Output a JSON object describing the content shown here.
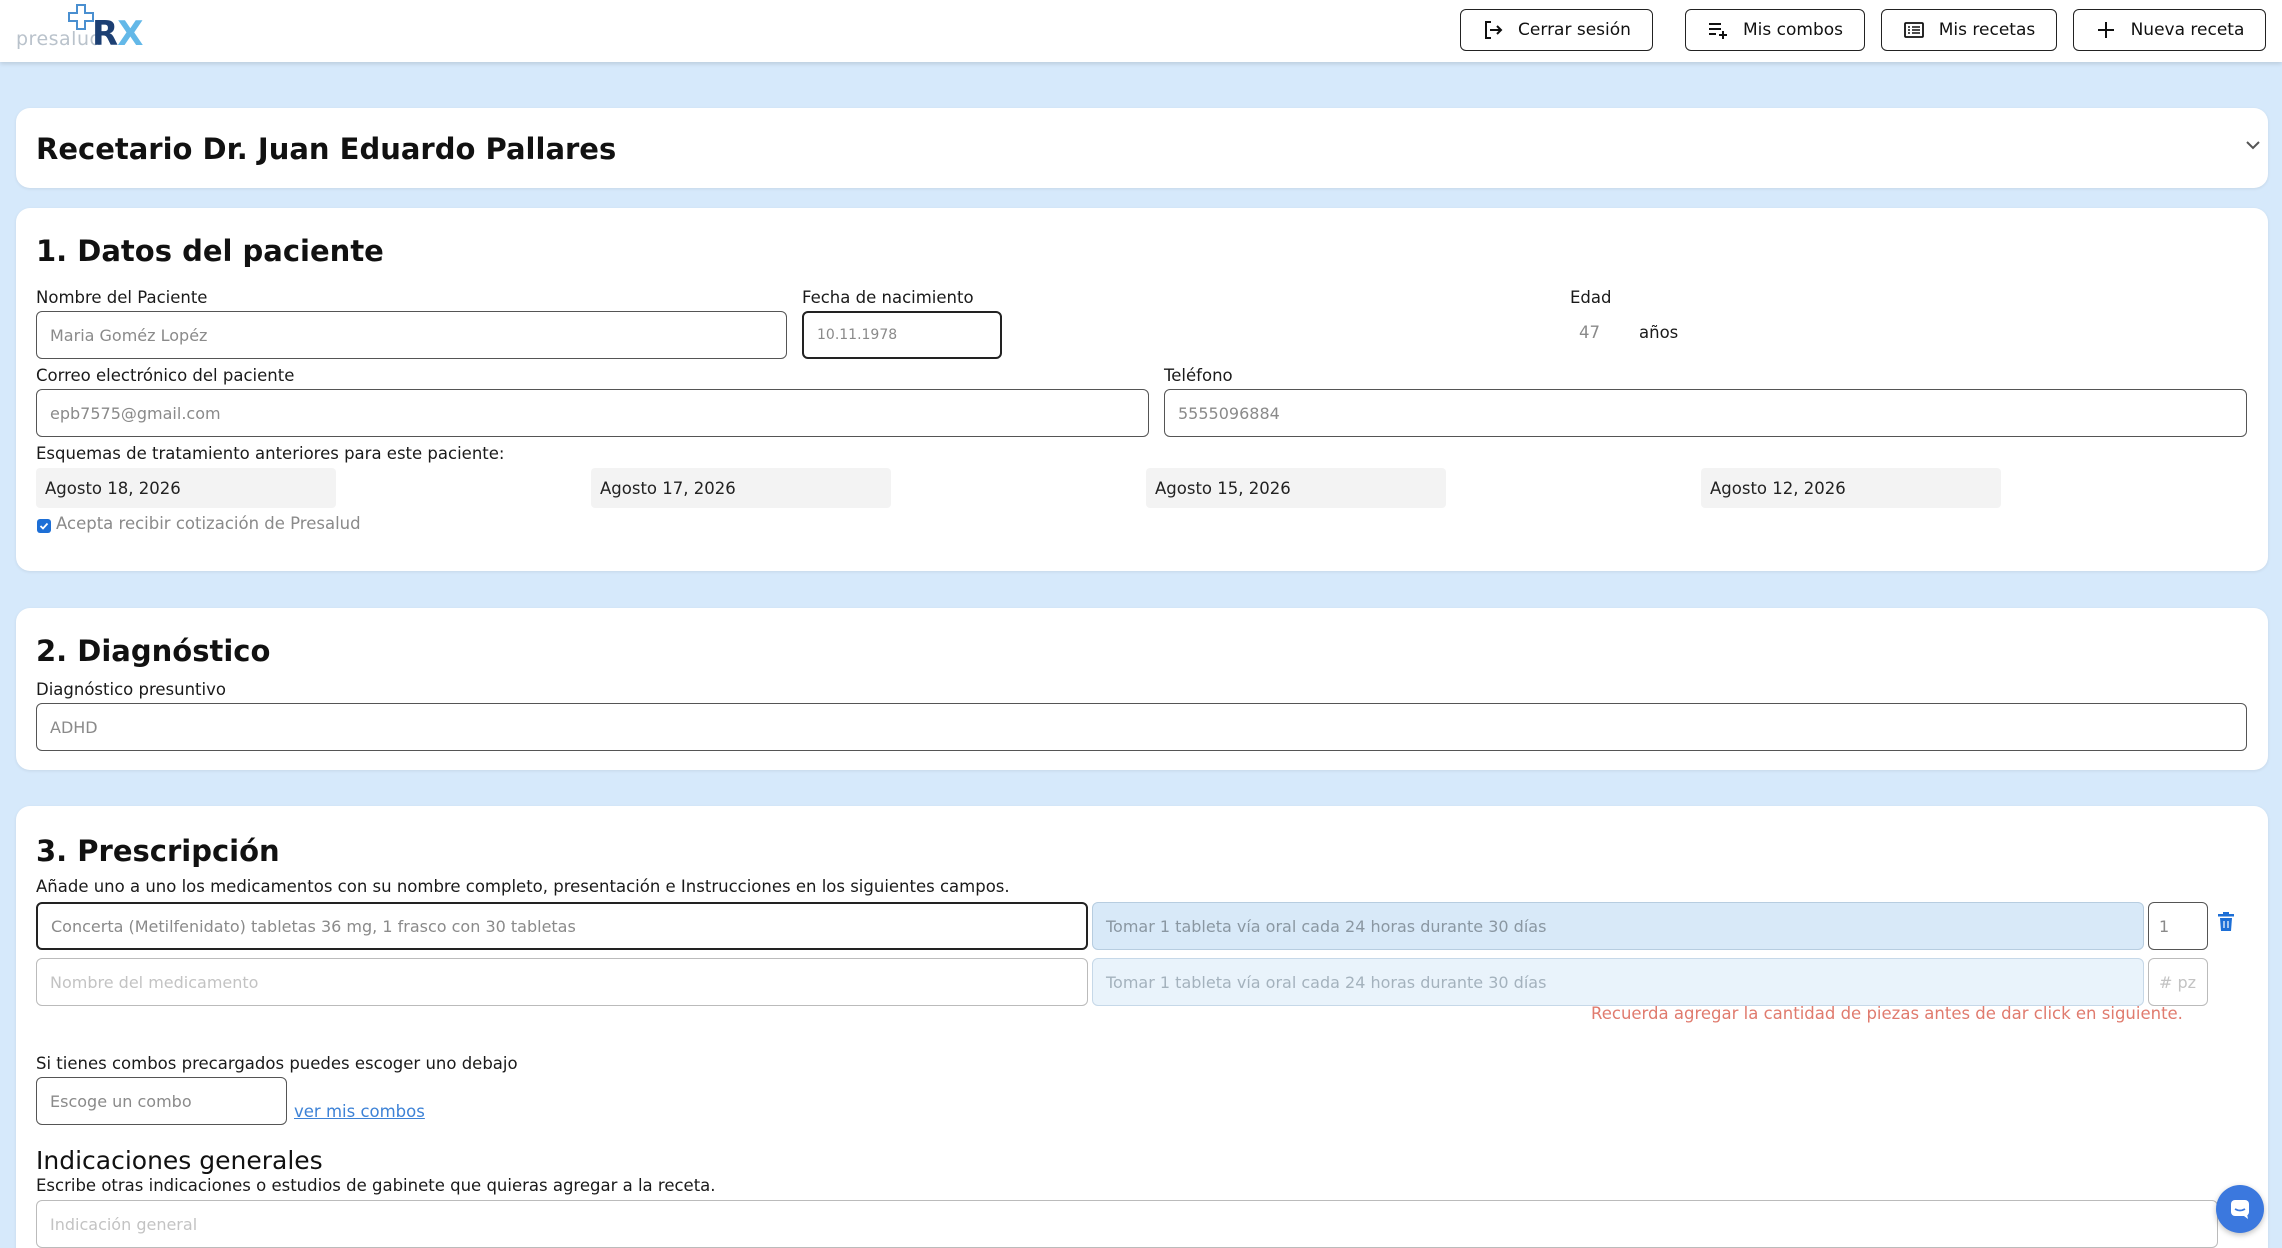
{
  "header": {
    "logo_word": "presalud",
    "logo_r": "R",
    "logo_x": "X",
    "logout_label": "Cerrar sesión",
    "combos_label": "Mis combos",
    "recetas_label": "Mis recetas",
    "nueva_label": "Nueva receta"
  },
  "recetario": {
    "title": "Recetario Dr. Juan Eduardo Pallares"
  },
  "datos": {
    "heading": "1. Datos del paciente",
    "nombre_label": "Nombre del Paciente",
    "nombre_value": "Maria Goméz Lopéz",
    "fecha_label": "Fecha de nacimiento",
    "fecha_value": "10.11.1978",
    "edad_label": "Edad",
    "edad_value": "47",
    "edad_unit": "años",
    "correo_label": "Correo electrónico del paciente",
    "correo_value": "epb7575@gmail.com",
    "telefono_label": "Teléfono",
    "telefono_value": "5555096884",
    "esquemas_label": "Esquemas de tratamiento anteriores para este paciente:",
    "esquemas": [
      "Agosto 18, 2026",
      "Agosto 17, 2026",
      "Agosto 15, 2026",
      "Agosto 12, 2026"
    ],
    "acepta_label": "Acepta recibir cotización de Presalud"
  },
  "diagnostico": {
    "heading": "2. Diagnóstico",
    "label": "Diagnóstico presuntivo",
    "value": "ADHD"
  },
  "prescripcion": {
    "heading": "3. Prescripción",
    "instructions": "Añade uno a uno los medicamentos con su nombre completo, presentación e Instrucciones en los siguientes campos.",
    "row1": {
      "medicamento": "Concerta (Metilfenidato) tabletas 36 mg, 1 frasco con 30 tabletas",
      "indicacion": "Tomar 1 tableta vía oral cada 24 horas durante 30 días",
      "piezas": "1"
    },
    "row2": {
      "medicamento_placeholder": "Nombre del medicamento",
      "indicacion_placeholder": "Tomar 1 tableta vía oral cada 24 horas durante 30 días",
      "piezas_placeholder": "# pz"
    },
    "recuerda": "Recuerda agregar la cantidad de piezas antes de dar click en siguiente.",
    "combos_label": "Si tienes combos precargados puedes escoger uno debajo",
    "combo_placeholder": "Escoge un combo",
    "ver_combos": "ver mis combos",
    "indicaciones_heading": "Indicaciones generales",
    "indicaciones_desc": "Escribe otras indicaciones o estudios de gabinete que quieras agregar a la receta.",
    "indicacion_placeholder": "Indicación general"
  }
}
